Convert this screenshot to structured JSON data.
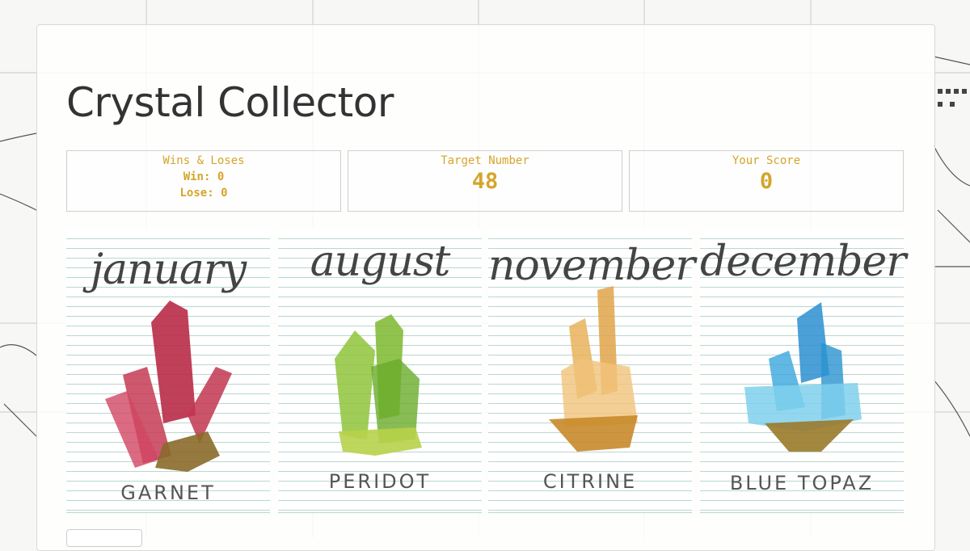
{
  "app": {
    "title": "Crystal Collector"
  },
  "stats": {
    "wins_loses_label": "Wins & Loses",
    "win_label": "Win:",
    "win_value": "0",
    "lose_label": "Lose:",
    "lose_value": "0",
    "target_label": "Target Number",
    "target_value": "48",
    "score_label": "Your Score",
    "score_value": "0"
  },
  "crystals": [
    {
      "month": "january",
      "name": "GARNET",
      "color": "#c0334e"
    },
    {
      "month": "august",
      "name": "PERIDOT",
      "color": "#8fc43b"
    },
    {
      "month": "november",
      "name": "CITRINE",
      "color": "#e0a44a"
    },
    {
      "month": "december",
      "name": "BLUE TOPAZ",
      "color": "#3aa6dc"
    }
  ],
  "colors": {
    "accent": "#d4a52b",
    "ruled_line": "#b9d7d0"
  }
}
